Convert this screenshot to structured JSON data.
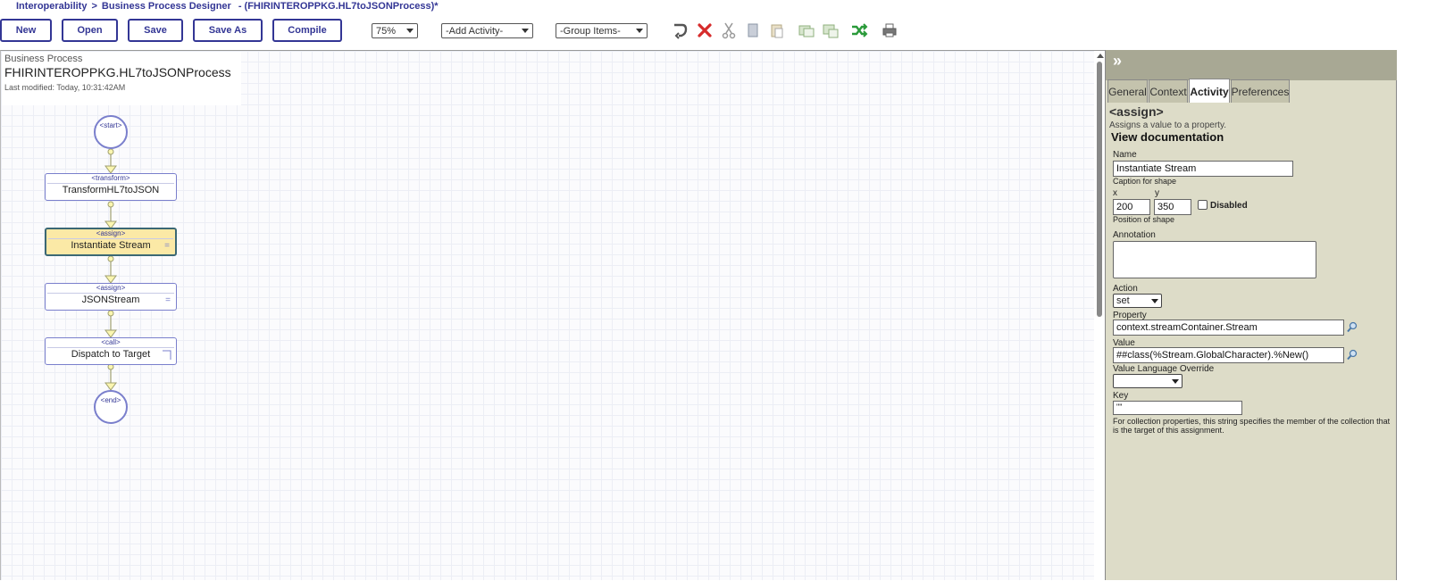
{
  "breadcrumb": {
    "root": "Interoperability",
    "separator": ">",
    "page": "Business Process Designer",
    "document": "- (FHIRINTEROPPKG.HL7toJSONProcess)*"
  },
  "toolbar": {
    "new_label": "New",
    "open_label": "Open",
    "save_label": "Save",
    "save_as_label": "Save As",
    "compile_label": "Compile",
    "zoom_value": "75%",
    "add_activity_value": "-Add Activity-",
    "group_items_value": "-Group Items-",
    "icons": [
      "undo-icon",
      "delete-icon",
      "cut-icon",
      "copy-icon",
      "paste-icon",
      "group-icon",
      "ungroup-icon",
      "shuffle-icon",
      "print-icon"
    ]
  },
  "process": {
    "label": "Business Process",
    "name": "FHIRINTEROPPKG.HL7toJSONProcess",
    "modified": "Last modified: Today, 10:31:42AM"
  },
  "diagram": {
    "start": "<start>",
    "end": "<end>",
    "activities": [
      {
        "type": "<transform>",
        "name": "TransformHL7toJSON",
        "mark": ""
      },
      {
        "type": "<assign>",
        "name": "Instantiate Stream",
        "mark": "=",
        "selected": true
      },
      {
        "type": "<assign>",
        "name": "JSONStream",
        "mark": "="
      },
      {
        "type": "<call>",
        "name": "Dispatch to Target",
        "mark": ""
      }
    ]
  },
  "panel": {
    "collapse_glyph": "»",
    "tabs": [
      {
        "label": "General"
      },
      {
        "label": "Context"
      },
      {
        "label": "Activity",
        "active": true
      },
      {
        "label": "Preferences"
      }
    ],
    "activity_title": "<assign>",
    "activity_desc": "Assigns a value to a property.",
    "doc_link": "View documentation",
    "name_label": "Name",
    "name_value": "Instantiate Stream",
    "name_hint": "Caption for shape",
    "x_label": "x",
    "y_label": "y",
    "x_value": "200",
    "y_value": "350",
    "disabled_label": "Disabled",
    "position_hint": "Position of shape",
    "annotation_label": "Annotation",
    "annotation_value": "",
    "action_label": "Action",
    "action_value": "set",
    "property_label": "Property",
    "property_value": "context.streamContainer.Stream",
    "value_label": "Value",
    "value_value": "##class(%Stream.GlobalCharacter).%New()",
    "override_label": "Value Language Override",
    "override_value": "",
    "key_label": "Key",
    "key_value": "\"\"",
    "key_hint": "For collection properties, this string specifies the member of the collection that is the target of this assignment."
  },
  "colors": {
    "accent": "#333695",
    "shape_border": "#7a7fcc",
    "selected_fill": "#fbe9a6",
    "panel_bg": "#dddcc8"
  }
}
